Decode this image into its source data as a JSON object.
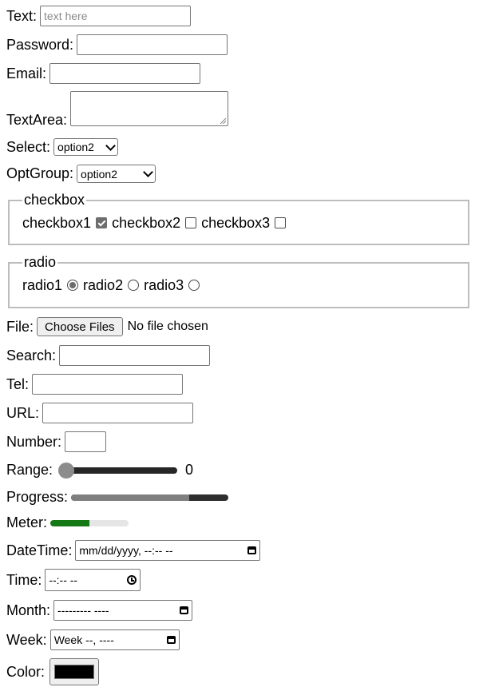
{
  "text": {
    "label": "Text:",
    "placeholder": "text here",
    "value": ""
  },
  "password": {
    "label": "Password:",
    "value": ""
  },
  "email": {
    "label": "Email:",
    "value": ""
  },
  "textarea": {
    "label": "TextArea:",
    "value": ""
  },
  "select": {
    "label": "Select:",
    "selected": "option2"
  },
  "optgroup": {
    "label": "OptGroup:",
    "selected": "option2"
  },
  "checkbox_group": {
    "legend": "checkbox",
    "items": [
      {
        "label": "checkbox1",
        "checked": true
      },
      {
        "label": "checkbox2",
        "checked": false
      },
      {
        "label": "checkbox3",
        "checked": false
      }
    ]
  },
  "radio_group": {
    "legend": "radio",
    "items": [
      {
        "label": "radio1",
        "checked": true
      },
      {
        "label": "radio2",
        "checked": false
      },
      {
        "label": "radio3",
        "checked": false
      }
    ]
  },
  "file": {
    "label": "File:",
    "button": "Choose Files",
    "status": "No file chosen"
  },
  "search": {
    "label": "Search:",
    "value": ""
  },
  "tel": {
    "label": "Tel:",
    "value": ""
  },
  "url": {
    "label": "URL:",
    "value": ""
  },
  "number": {
    "label": "Number:",
    "value": ""
  },
  "range": {
    "label": "Range:",
    "value": "0",
    "fraction": 0
  },
  "progress": {
    "label": "Progress:",
    "fraction": 0.75
  },
  "meter": {
    "label": "Meter:",
    "fraction": 0.5,
    "color": "#147814"
  },
  "datetime": {
    "label": "DateTime:",
    "value": "mm/dd/yyyy, --:-- --"
  },
  "time": {
    "label": "Time:",
    "value": "--:-- --"
  },
  "month": {
    "label": "Month:",
    "value": "--------- ----"
  },
  "week": {
    "label": "Week:",
    "value": "Week --, ----"
  },
  "color": {
    "label": "Color:",
    "value": "#000000"
  }
}
